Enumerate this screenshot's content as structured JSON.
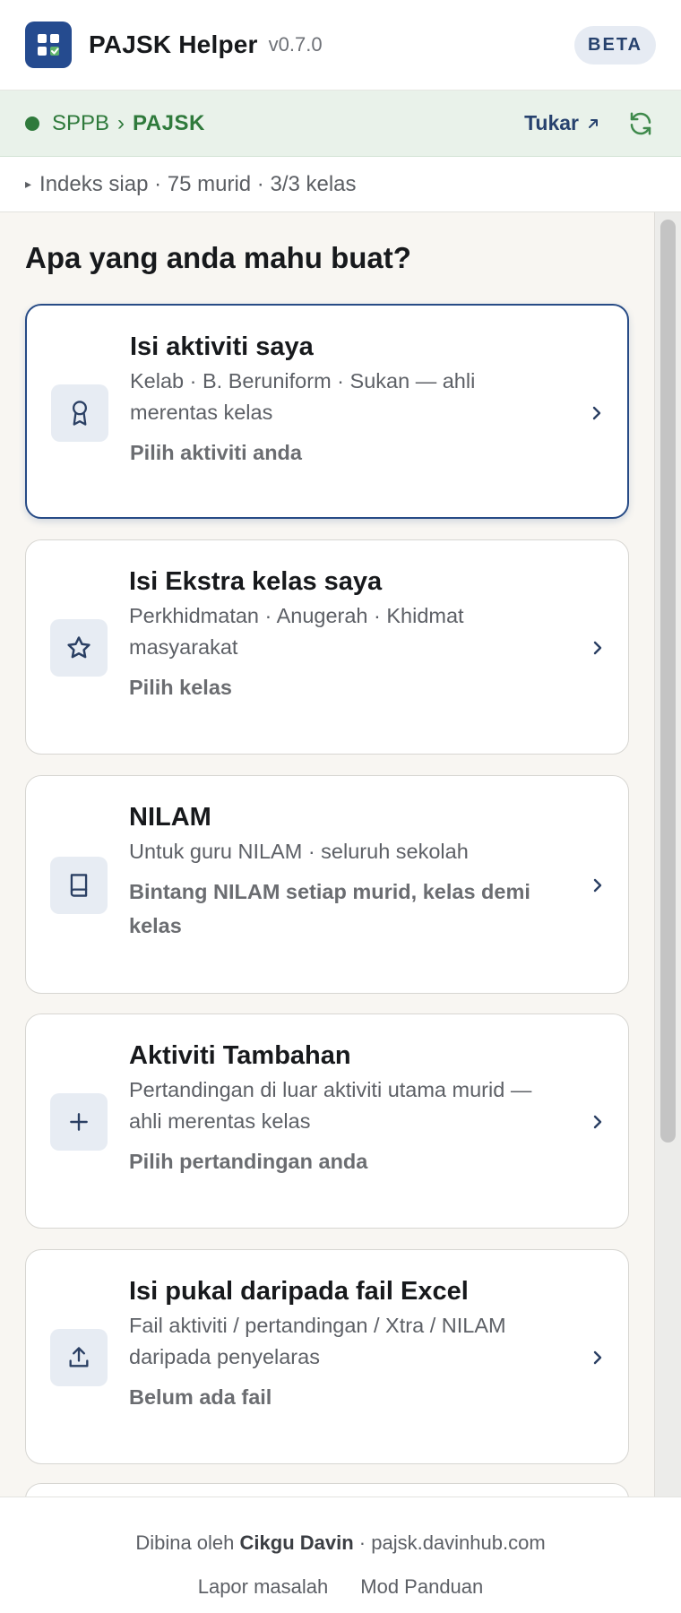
{
  "header": {
    "title": "PAJSK Helper",
    "version": "v0.7.0",
    "badge": "BETA",
    "accent_color": "#254b8f"
  },
  "context": {
    "parent": "SPPB",
    "separator": "›",
    "current": "PAJSK",
    "switch_label": "Tukar",
    "status_color": "#2f7a3c"
  },
  "index_status": "Indeks siap · 75 murid · 3/3 kelas",
  "main": {
    "heading": "Apa yang anda mahu buat?",
    "cards": [
      {
        "title": "Isi aktiviti saya",
        "desc": "Kelab · B. Beruniform · Sukan — ahli merentas kelas",
        "action": "Pilih aktiviti anda",
        "icon": "award-ribbon-icon"
      },
      {
        "title": "Isi Ekstra kelas saya",
        "desc": "Perkhidmatan · Anugerah · Khidmat masyarakat",
        "action": "Pilih kelas",
        "icon": "star-icon"
      },
      {
        "title": "NILAM",
        "desc": "Untuk guru NILAM · seluruh sekolah",
        "action": "Bintang NILAM setiap murid, kelas demi kelas",
        "icon": "book-icon"
      },
      {
        "title": "Aktiviti Tambahan",
        "desc": "Pertandingan di luar aktiviti utama murid — ahli merentas kelas",
        "action": "Pilih pertandingan anda",
        "icon": "plus-icon"
      },
      {
        "title": "Isi pukal daripada fail Excel",
        "desc": "Fail aktiviti / pertandingan / Xtra / NILAM daripada penyelaras",
        "action": "Belum ada fail",
        "icon": "upload-icon"
      }
    ]
  },
  "footer": {
    "credit_prefix": "Dibina oleh",
    "author": "Cikgu Davin",
    "credit_suffix": "· pajsk.davinhub.com",
    "links": [
      "Lapor masalah",
      "Mod Panduan"
    ]
  }
}
